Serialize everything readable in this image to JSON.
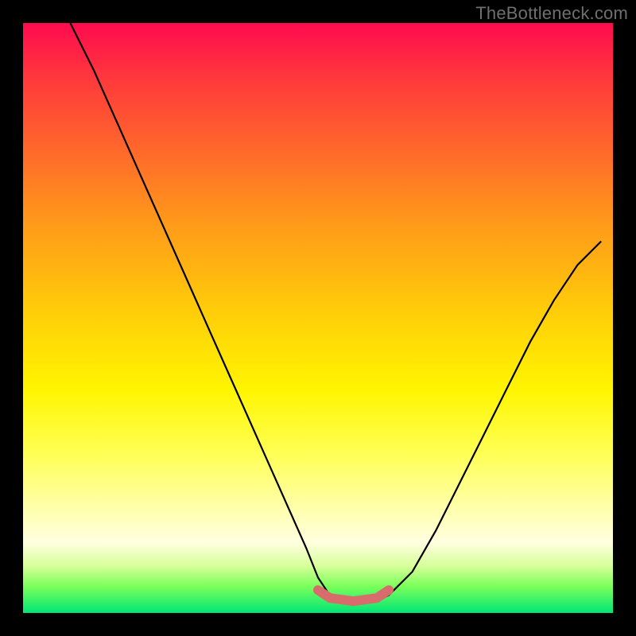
{
  "watermark": "TheBottleneck.com",
  "colors": {
    "background": "#000000",
    "gradient_top": "#ff0b4f",
    "gradient_bottom": "#00e676",
    "curve": "#000000",
    "plateau": "#d86b6b"
  },
  "chart_data": {
    "type": "line",
    "title": "",
    "xlabel": "",
    "ylabel": "",
    "xlim": [
      0,
      100
    ],
    "ylim": [
      0,
      100
    ],
    "series": [
      {
        "name": "bottleneck-curve",
        "x": [
          8,
          12,
          16,
          20,
          24,
          28,
          32,
          36,
          40,
          44,
          48,
          50,
          52,
          54,
          56,
          58,
          60,
          62,
          66,
          70,
          74,
          78,
          82,
          86,
          90,
          94,
          98
        ],
        "y": [
          100,
          92,
          83,
          74,
          65,
          56,
          47,
          38,
          29,
          20,
          11,
          6,
          3,
          2,
          2,
          2,
          2,
          3,
          7,
          14,
          22,
          30,
          38,
          46,
          53,
          59,
          63
        ]
      }
    ],
    "annotations": [
      {
        "name": "plateau",
        "x_start": 50,
        "x_end": 62,
        "y": 2
      }
    ]
  }
}
